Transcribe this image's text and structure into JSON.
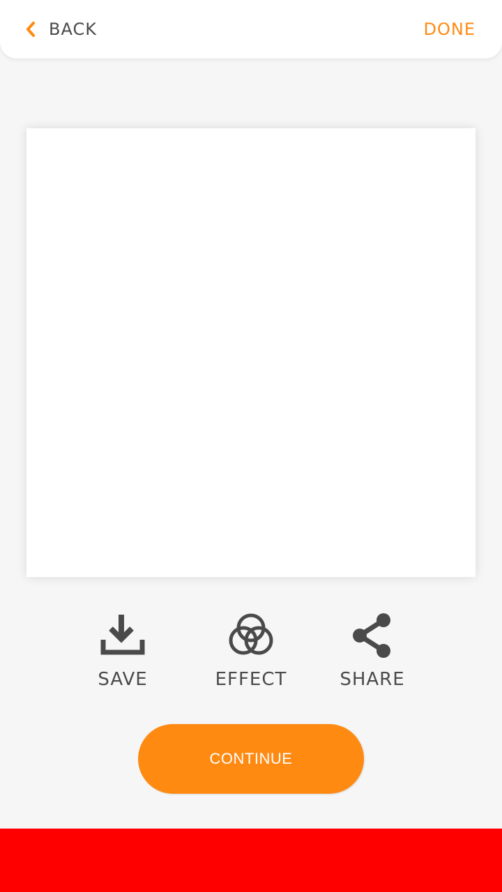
{
  "header": {
    "back_label": "BACK",
    "done_label": "DONE"
  },
  "actions": {
    "save_label": "SAVE",
    "effect_label": "EFFECT",
    "share_label": "SHARE"
  },
  "continue_label": "CONTINUE",
  "colors": {
    "accent": "#ff8a12",
    "text": "#4a4a4a",
    "background": "#f6f6f6",
    "banner": "#ff0000"
  },
  "icons": {
    "back": "chevron-left-icon",
    "save": "download-icon",
    "effect": "overlapping-circles-icon",
    "share": "share-icon"
  }
}
